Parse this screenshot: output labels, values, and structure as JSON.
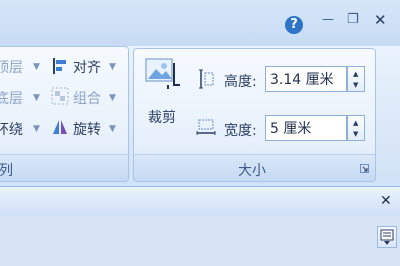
{
  "window": {
    "help_glyph": "?",
    "minimize_glyph": "—",
    "restore_glyph": "❐",
    "close_glyph": "✕"
  },
  "arrange_group": {
    "row1_label": "顶层",
    "row2_label": "底层",
    "row3_label": "环绕",
    "align_label": "对齐",
    "group_label": "组合",
    "rotate_label": "旋转",
    "group_title": "列"
  },
  "crop": {
    "label": "裁剪"
  },
  "size_group": {
    "title": "大小",
    "height_label": "高度:",
    "height_value": "3.14 厘米",
    "width_label": "宽度:",
    "width_value": "5 厘米"
  },
  "dialog": {
    "close_glyph": "✕"
  },
  "colors": {
    "help_blue": "#2f73c9",
    "accent_text": "#2b3f66",
    "disabled_text": "#8ea4c6"
  }
}
